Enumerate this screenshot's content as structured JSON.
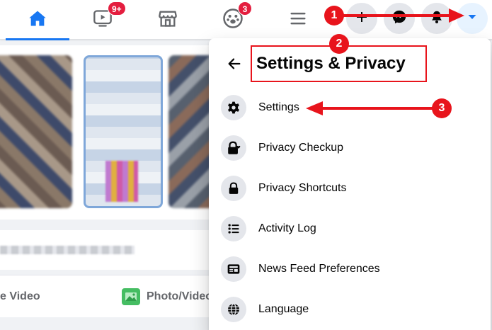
{
  "nav": {
    "watch_badge": "9+",
    "groups_badge": "3"
  },
  "feed": {
    "live_label": "e Video",
    "photo_label": "Photo/Video"
  },
  "settings_menu": {
    "title": "Settings & Privacy",
    "items": [
      {
        "label": "Settings",
        "icon": "gear-icon"
      },
      {
        "label": "Privacy Checkup",
        "icon": "lock-heart-icon"
      },
      {
        "label": "Privacy Shortcuts",
        "icon": "lock-icon"
      },
      {
        "label": "Activity Log",
        "icon": "list-icon"
      },
      {
        "label": "News Feed Preferences",
        "icon": "feed-icon"
      },
      {
        "label": "Language",
        "icon": "globe-icon"
      }
    ]
  },
  "annotations": {
    "step1": "1",
    "step2": "2",
    "step3": "3",
    "color": "#e8141c"
  },
  "colors": {
    "brand": "#1877f2",
    "badge": "#e41e3f"
  }
}
